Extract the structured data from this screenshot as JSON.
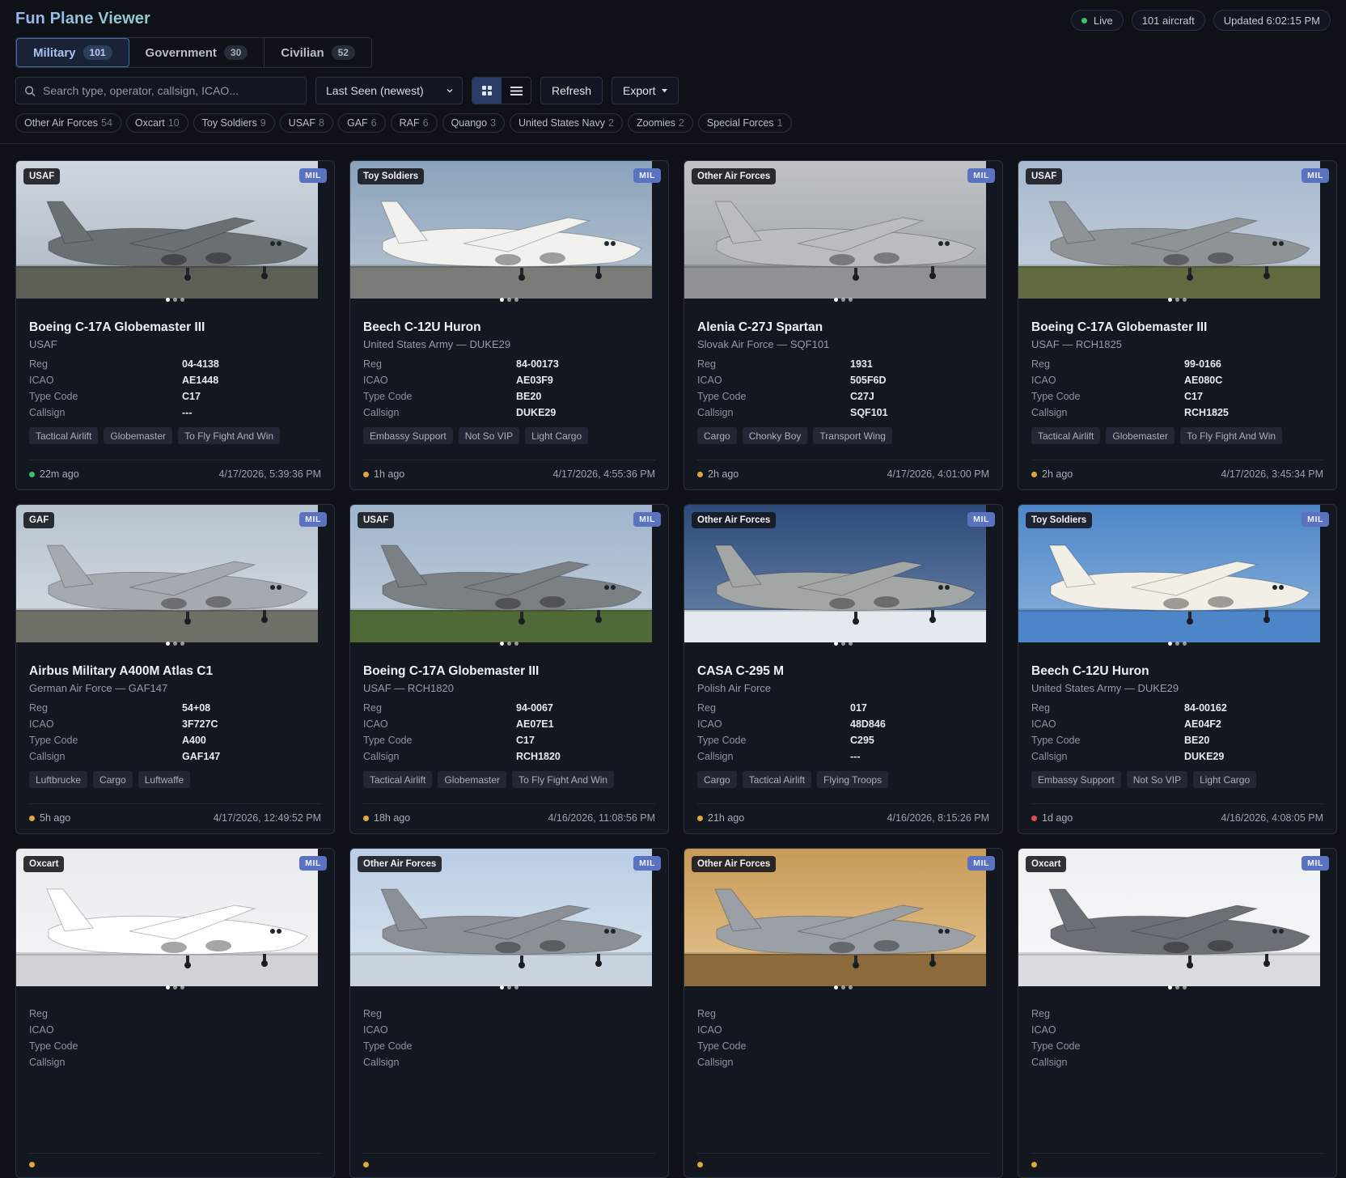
{
  "app": {
    "title": "Fun Plane Viewer"
  },
  "status": {
    "live": "Live",
    "count": "101 aircraft",
    "updated": "Updated 6:02:15 PM"
  },
  "tabs": [
    {
      "label": "Military",
      "count": "101",
      "active": true
    },
    {
      "label": "Government",
      "count": "30",
      "active": false
    },
    {
      "label": "Civilian",
      "count": "52",
      "active": false
    }
  ],
  "search": {
    "placeholder": "Search type, operator, callsign, ICAO..."
  },
  "sort": {
    "value": "Last Seen (newest)"
  },
  "buttons": {
    "refresh": "Refresh",
    "export": "Export"
  },
  "chips": [
    {
      "label": "Other Air Forces",
      "count": "54"
    },
    {
      "label": "Oxcart",
      "count": "10"
    },
    {
      "label": "Toy Soldiers",
      "count": "9"
    },
    {
      "label": "USAF",
      "count": "8"
    },
    {
      "label": "GAF",
      "count": "6"
    },
    {
      "label": "RAF",
      "count": "6"
    },
    {
      "label": "Quango",
      "count": "3"
    },
    {
      "label": "United States Navy",
      "count": "2"
    },
    {
      "label": "Zoomies",
      "count": "2"
    },
    {
      "label": "Special Forces",
      "count": "1"
    }
  ],
  "spec_labels": {
    "reg": "Reg",
    "icao": "ICAO",
    "type": "Type Code",
    "callsign": "Callsign"
  },
  "mil_badge": "MIL",
  "colors": {
    "fresh": "#3ac26b",
    "recent": "#e0a83a",
    "stale": "#e0504a",
    "accent": "#5a72c0"
  },
  "cards": [
    {
      "group": "USAF",
      "title": "Boeing C-17A Globemaster III",
      "sub": "USAF",
      "reg": "04-4138",
      "icao": "AE1448",
      "type": "C17",
      "callsign": "---",
      "tags": [
        "Tactical Airlift",
        "Globemaster",
        "To Fly Fight And Win"
      ],
      "ago": "22m ago",
      "time": "4/17/2026, 5:39:36 PM",
      "freshness": "fresh"
    },
    {
      "group": "Toy Soldiers",
      "title": "Beech C-12U Huron",
      "sub": "United States Army — DUKE29",
      "reg": "84-00173",
      "icao": "AE03F9",
      "type": "BE20",
      "callsign": "DUKE29",
      "tags": [
        "Embassy Support",
        "Not So VIP",
        "Light Cargo"
      ],
      "ago": "1h ago",
      "time": "4/17/2026, 4:55:36 PM",
      "freshness": "recent"
    },
    {
      "group": "Other Air Forces",
      "title": "Alenia C-27J Spartan",
      "sub": "Slovak Air Force — SQF101",
      "reg": "1931",
      "icao": "505F6D",
      "type": "C27J",
      "callsign": "SQF101",
      "tags": [
        "Cargo",
        "Chonky Boy",
        "Transport Wing"
      ],
      "ago": "2h ago",
      "time": "4/17/2026, 4:01:00 PM",
      "freshness": "recent"
    },
    {
      "group": "USAF",
      "title": "Boeing C-17A Globemaster III",
      "sub": "USAF — RCH1825",
      "reg": "99-0166",
      "icao": "AE080C",
      "type": "C17",
      "callsign": "RCH1825",
      "tags": [
        "Tactical Airlift",
        "Globemaster",
        "To Fly Fight And Win"
      ],
      "ago": "2h ago",
      "time": "4/17/2026, 3:45:34 PM",
      "freshness": "recent"
    },
    {
      "group": "GAF",
      "title": "Airbus Military A400M Atlas C1",
      "sub": "German Air Force — GAF147",
      "reg": "54+08",
      "icao": "3F727C",
      "type": "A400",
      "callsign": "GAF147",
      "tags": [
        "Luftbrucke",
        "Cargo",
        "Luftwaffe"
      ],
      "ago": "5h ago",
      "time": "4/17/2026, 12:49:52 PM",
      "freshness": "recent"
    },
    {
      "group": "USAF",
      "title": "Boeing C-17A Globemaster III",
      "sub": "USAF — RCH1820",
      "reg": "94-0067",
      "icao": "AE07E1",
      "type": "C17",
      "callsign": "RCH1820",
      "tags": [
        "Tactical Airlift",
        "Globemaster",
        "To Fly Fight And Win"
      ],
      "ago": "18h ago",
      "time": "4/16/2026, 11:08:56 PM",
      "freshness": "recent"
    },
    {
      "group": "Other Air Forces",
      "title": "CASA C-295 M",
      "sub": "Polish Air Force",
      "reg": "017",
      "icao": "48D846",
      "type": "C295",
      "callsign": "---",
      "tags": [
        "Cargo",
        "Tactical Airlift",
        "Flying Troops"
      ],
      "ago": "21h ago",
      "time": "4/16/2026, 8:15:26 PM",
      "freshness": "recent"
    },
    {
      "group": "Toy Soldiers",
      "title": "Beech C-12U Huron",
      "sub": "United States Army — DUKE29",
      "reg": "84-00162",
      "icao": "AE04F2",
      "type": "BE20",
      "callsign": "DUKE29",
      "tags": [
        "Embassy Support",
        "Not So VIP",
        "Light Cargo"
      ],
      "ago": "1d ago",
      "time": "4/16/2026, 4:08:05 PM",
      "freshness": "stale"
    },
    {
      "group": "Oxcart",
      "title": "",
      "sub": "",
      "reg": "",
      "icao": "",
      "type": "",
      "callsign": "",
      "tags": [],
      "ago": "",
      "time": "",
      "freshness": "recent"
    },
    {
      "group": "Other Air Forces",
      "title": "",
      "sub": "",
      "reg": "",
      "icao": "",
      "type": "",
      "callsign": "",
      "tags": [],
      "ago": "",
      "time": "",
      "freshness": "recent"
    },
    {
      "group": "Other Air Forces",
      "title": "",
      "sub": "",
      "reg": "",
      "icao": "",
      "type": "",
      "callsign": "",
      "tags": [],
      "ago": "",
      "time": "",
      "freshness": "recent"
    },
    {
      "group": "Oxcart",
      "title": "",
      "sub": "",
      "reg": "",
      "icao": "",
      "type": "",
      "callsign": "",
      "tags": [],
      "ago": "",
      "time": "",
      "freshness": "recent"
    }
  ]
}
